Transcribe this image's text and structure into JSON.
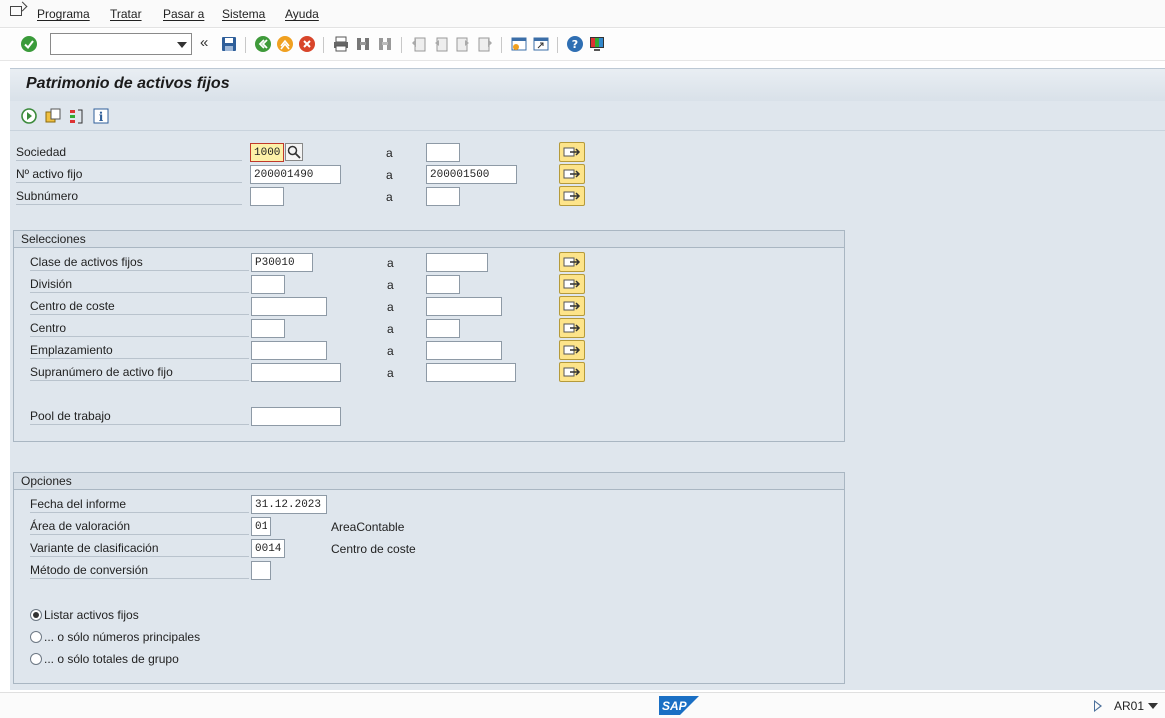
{
  "menu": {
    "items": [
      {
        "label": "Programa"
      },
      {
        "label": "Tratar"
      },
      {
        "label": "Pasar a"
      },
      {
        "label": "Sistema"
      },
      {
        "label": "Ayuda"
      }
    ]
  },
  "toolbar": {
    "command_value": "",
    "back_glyph": "«",
    "icons": [
      "check-icon",
      "save-icon",
      "back-icon",
      "exit-icon",
      "cancel-icon",
      "print-icon",
      "find-icon",
      "find-next-icon",
      "first-page-icon",
      "previous-page-icon",
      "next-page-icon",
      "last-page-icon",
      "create-session-icon",
      "shortcut-icon",
      "help-icon",
      "customize-layout-icon"
    ]
  },
  "screen": {
    "title": "Patrimonio de activos fijos",
    "app_toolbar_icons": [
      "execute-icon",
      "get-variant-icon",
      "selection-options-icon",
      "program-info-icon"
    ],
    "range_to": "a",
    "top_fields": [
      {
        "label": "Sociedad",
        "from": "1000",
        "to": ""
      },
      {
        "label": "Nº activo fijo",
        "from": "200001490",
        "to": "200001500"
      },
      {
        "label": "Subnúmero",
        "from": "",
        "to": ""
      }
    ],
    "selecciones": {
      "title": "Selecciones",
      "fields": [
        {
          "label": "Clase de activos fijos",
          "from": "P30010",
          "to": ""
        },
        {
          "label": "División",
          "from": "",
          "to": ""
        },
        {
          "label": "Centro de coste",
          "from": "",
          "to": ""
        },
        {
          "label": "Centro",
          "from": "",
          "to": ""
        },
        {
          "label": "Emplazamiento",
          "from": "",
          "to": ""
        },
        {
          "label": "Supranúmero de activo fijo",
          "from": "",
          "to": ""
        }
      ],
      "pool_label": "Pool de trabajo",
      "pool_value": ""
    },
    "opciones": {
      "title": "Opciones",
      "fields": [
        {
          "label": "Fecha del informe",
          "value": "31.12.2023",
          "text": ""
        },
        {
          "label": "Área de valoración",
          "value": "01",
          "text": "AreaContable"
        },
        {
          "label": "Variante de clasificación",
          "value": "0014",
          "text": "Centro de coste"
        },
        {
          "label": "Método de conversión",
          "value": "",
          "text": ""
        }
      ],
      "radios": [
        {
          "label": "Listar activos fijos",
          "checked": true
        },
        {
          "label": "... o sólo números principales",
          "checked": false
        },
        {
          "label": "... o sólo totales de grupo",
          "checked": false
        }
      ]
    }
  },
  "status": {
    "logo": "SAP",
    "system": "AR01"
  },
  "colors": {
    "screen_bg": "#dfe6ed",
    "highlight_bg": "#fdf1a8",
    "multi_btn": "#fde48a",
    "sap_blue": "#1a6fc4"
  }
}
